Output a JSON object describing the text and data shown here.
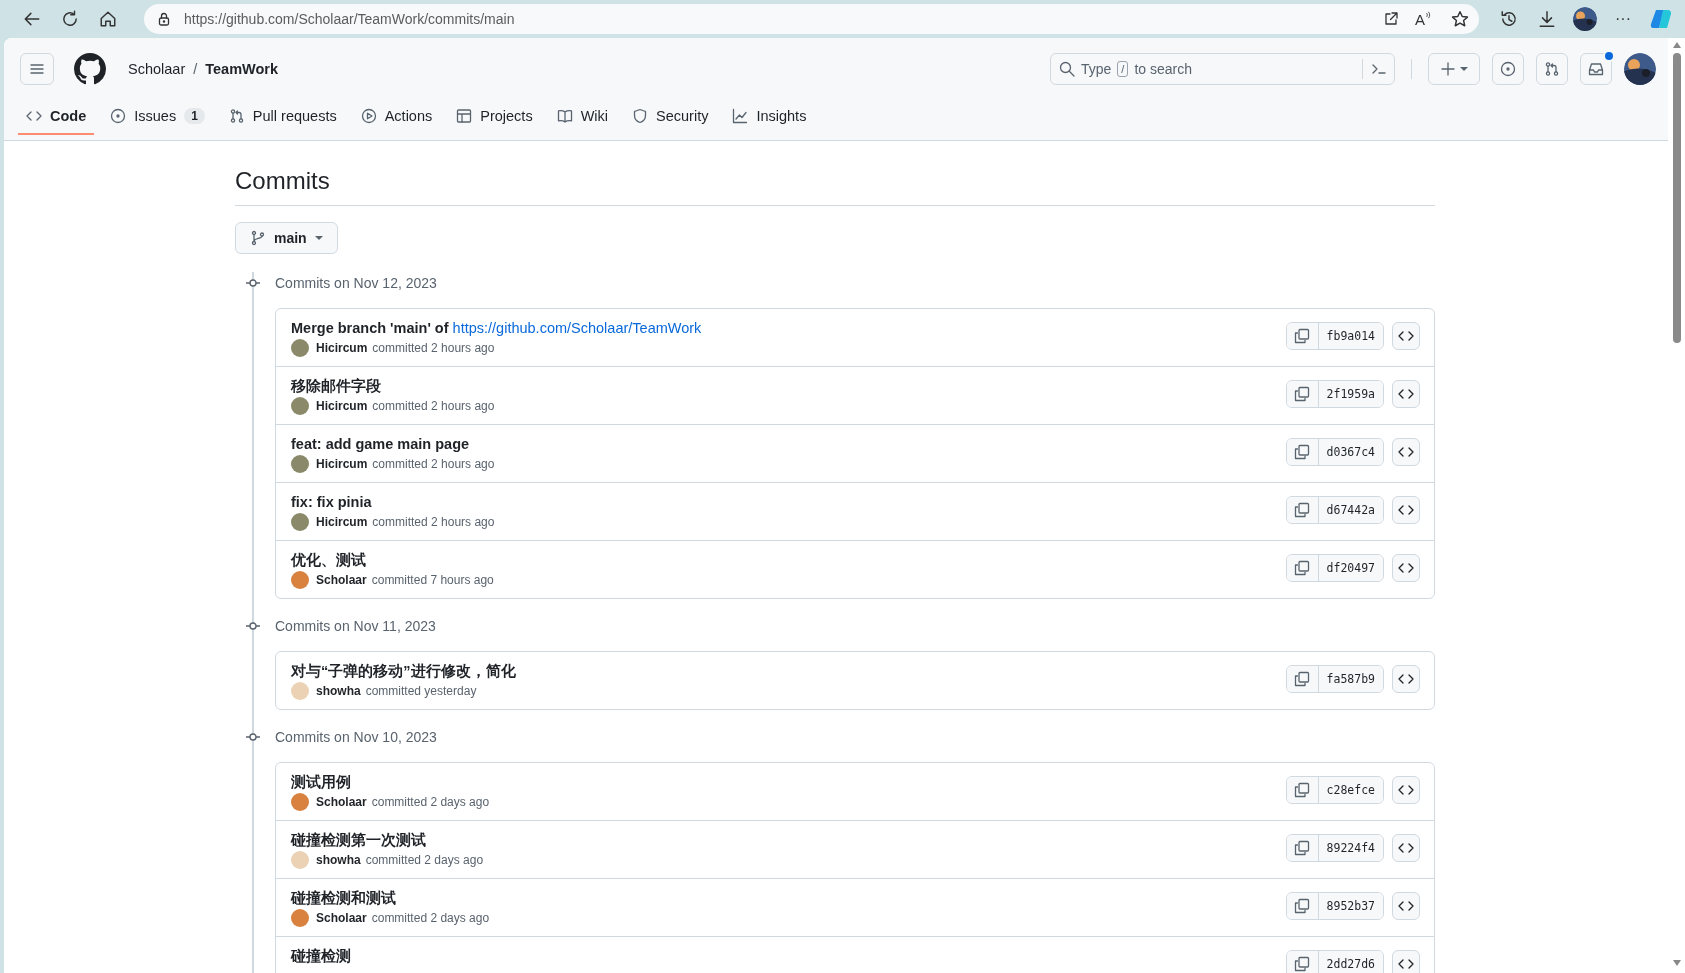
{
  "browser": {
    "url": "https://github.com/Scholaar/TeamWork/commits/main",
    "read_aloud": "A",
    "more": "···"
  },
  "header": {
    "owner": "Scholaar",
    "separator": "/",
    "repo": "TeamWork",
    "search": {
      "before": "Type",
      "key": "/",
      "after": "to search"
    },
    "inbox_unread": true
  },
  "tabs": [
    {
      "label": "Code",
      "selected": true
    },
    {
      "label": "Issues",
      "count": "1",
      "selected": false
    },
    {
      "label": "Pull requests",
      "selected": false
    },
    {
      "label": "Actions",
      "selected": false
    },
    {
      "label": "Projects",
      "selected": false
    },
    {
      "label": "Wiki",
      "selected": false
    },
    {
      "label": "Security",
      "selected": false
    },
    {
      "label": "Insights",
      "selected": false
    }
  ],
  "page_title": "Commits",
  "branch": "main",
  "groups": [
    {
      "heading": "Commits on Nov 12, 2023",
      "commits": [
        {
          "message": "Merge branch 'main' of",
          "link": "https://github.com/Scholaar/TeamWork",
          "author": "Hicircum",
          "color": "#8a8a6a",
          "when": "committed 2 hours ago",
          "sha": "fb9a014"
        },
        {
          "message": "移除邮件字段",
          "author": "Hicircum",
          "color": "#8a8a6a",
          "when": "committed 2 hours ago",
          "sha": "2f1959a"
        },
        {
          "message": "feat: add game main page",
          "author": "Hicircum",
          "color": "#8a8a6a",
          "when": "committed 2 hours ago",
          "sha": "d0367c4"
        },
        {
          "message": "fix: fix pinia",
          "author": "Hicircum",
          "color": "#8a8a6a",
          "when": "committed 2 hours ago",
          "sha": "d67442a"
        },
        {
          "message": "优化、测试",
          "author": "Scholaar",
          "color": "#d9823f",
          "when": "committed 7 hours ago",
          "sha": "df20497"
        }
      ]
    },
    {
      "heading": "Commits on Nov 11, 2023",
      "commits": [
        {
          "message": "对与“子弹的移动”进行修改，简化",
          "author": "showha",
          "color": "#ecd2b4",
          "when": "committed yesterday",
          "sha": "fa587b9"
        }
      ]
    },
    {
      "heading": "Commits on Nov 10, 2023",
      "commits": [
        {
          "message": "测试用例",
          "author": "Scholaar",
          "color": "#d9823f",
          "when": "committed 2 days ago",
          "sha": "c28efce"
        },
        {
          "message": "碰撞检测第一次测试",
          "author": "showha",
          "color": "#ecd2b4",
          "when": "committed 2 days ago",
          "sha": "89224f4"
        },
        {
          "message": "碰撞检测和测试",
          "author": "Scholaar",
          "color": "#d9823f",
          "when": "committed 2 days ago",
          "sha": "8952b37"
        },
        {
          "message": "碰撞检测",
          "sha": "2dd27d6"
        }
      ]
    }
  ]
}
